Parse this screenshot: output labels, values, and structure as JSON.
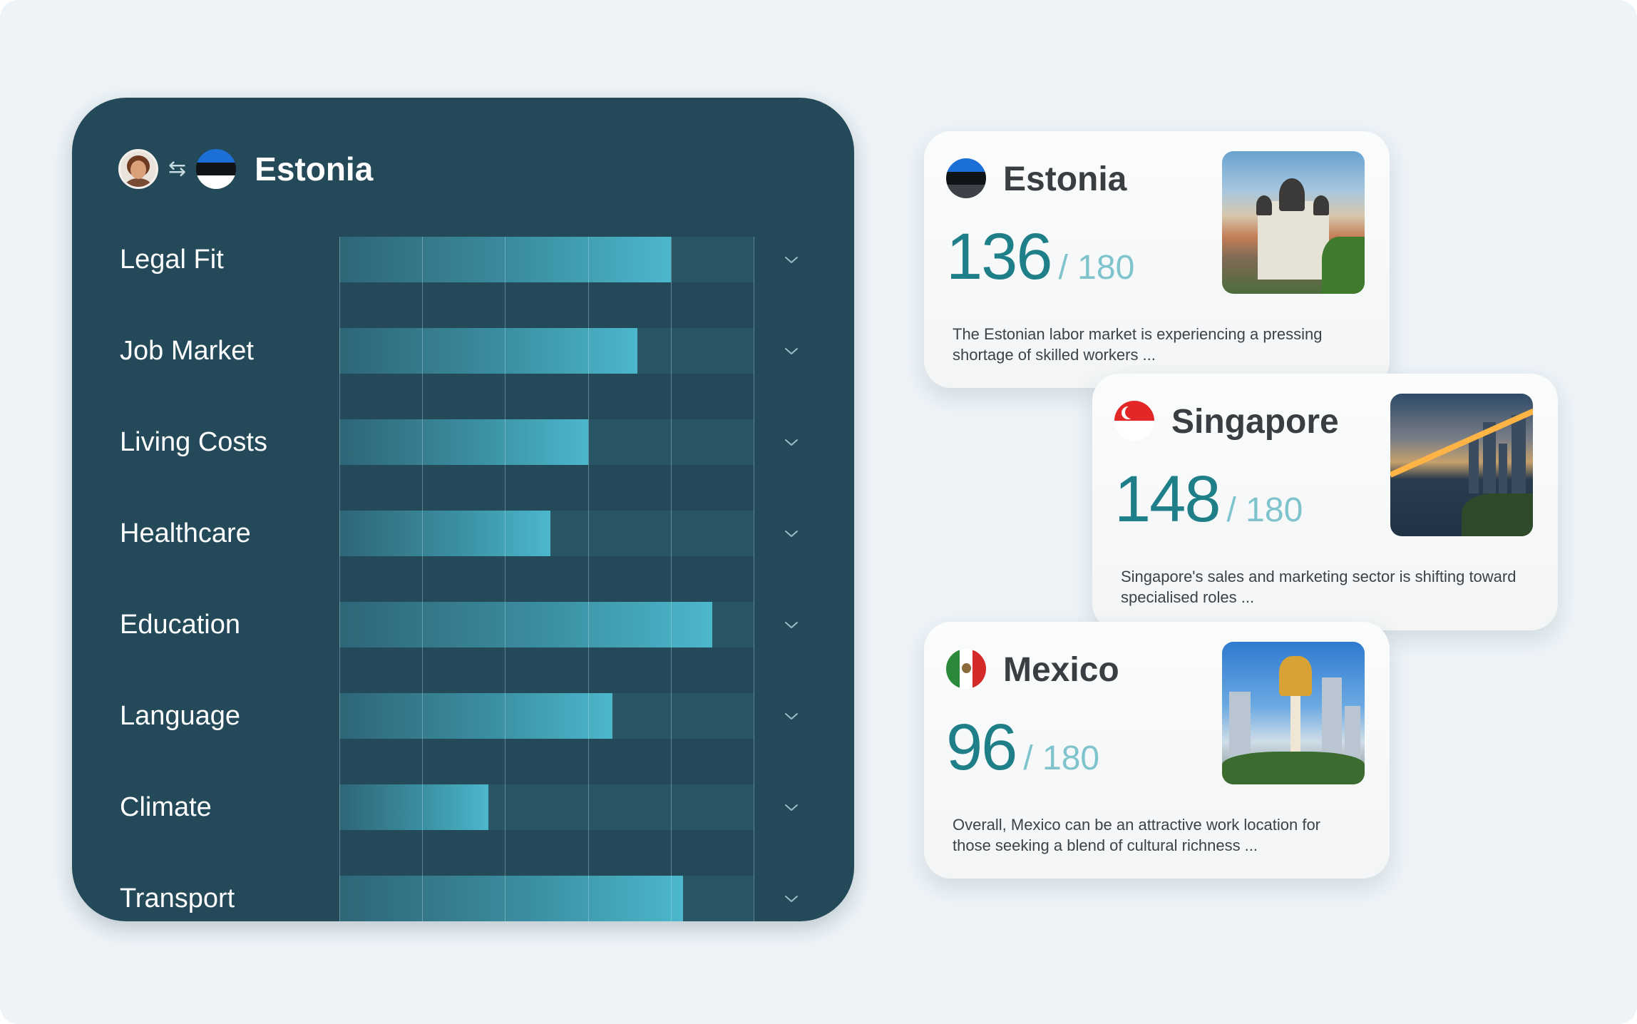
{
  "panel": {
    "title": "Estonia",
    "icons": {
      "avatar": "user-avatar",
      "swap": "swap-arrows-icon",
      "flag": "estonia-flag-icon"
    },
    "rows": [
      {
        "label": "Legal  Fit",
        "level": 0.8
      },
      {
        "label": "Job Market",
        "level": 0.72
      },
      {
        "label": "Living Costs",
        "level": 0.6
      },
      {
        "label": "Healthcare",
        "level": 0.51
      },
      {
        "label": "Education",
        "level": 0.9
      },
      {
        "label": "Language",
        "level": 0.66
      },
      {
        "label": "Climate",
        "level": 0.36
      },
      {
        "label": "Transport",
        "level": 0.83
      }
    ]
  },
  "cards": [
    {
      "country": "Estonia",
      "score": "136",
      "max": "/ 180",
      "description": "The Estonian labor market is experiencing a pressing shortage of skilled workers ..."
    },
    {
      "country": "Singapore",
      "score": "148",
      "max": "/ 180",
      "description": "Singapore's sales and marketing sector is shifting toward specialised roles ..."
    },
    {
      "country": "Mexico",
      "score": "96",
      "max": "/ 180",
      "description": "Overall, Mexico can be an attractive  work location for those seeking a blend of cultural richness  ..."
    }
  ],
  "colors": {
    "panel_bg": "#244959",
    "bar_track": "#295565",
    "bar_fill_end": "#4cb7cb",
    "score_teal": "#1e7f89",
    "score_max": "#7fc4cc",
    "page_bg": "#edf3f7"
  }
}
